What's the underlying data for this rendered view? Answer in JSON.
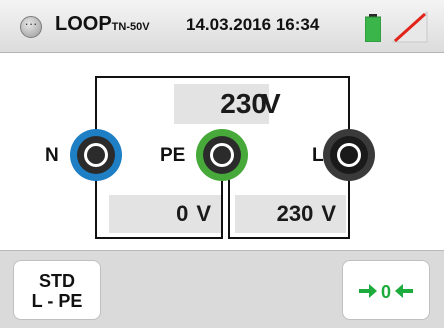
{
  "header": {
    "function_name": "LOOP",
    "function_sub": "TN-50V",
    "date": "14.03.2016",
    "time": "16:34",
    "battery_color": "#3ab54a",
    "signal_status": "wifi-disabled"
  },
  "measurements": {
    "top_value": "230",
    "top_unit": "V",
    "left_value": "0",
    "left_unit": "V",
    "right_value": "230",
    "right_unit": "V"
  },
  "terminals": {
    "n_label": "N",
    "n_color": "#1e7fc4",
    "pe_label": "PE",
    "pe_color": "#47a93a",
    "l_label": "L",
    "l_color": "#3a3a3a"
  },
  "footer": {
    "std_line1": "STD",
    "std_line2": "L - PE",
    "zero_label": "0",
    "zero_color": "#1cab3c"
  }
}
